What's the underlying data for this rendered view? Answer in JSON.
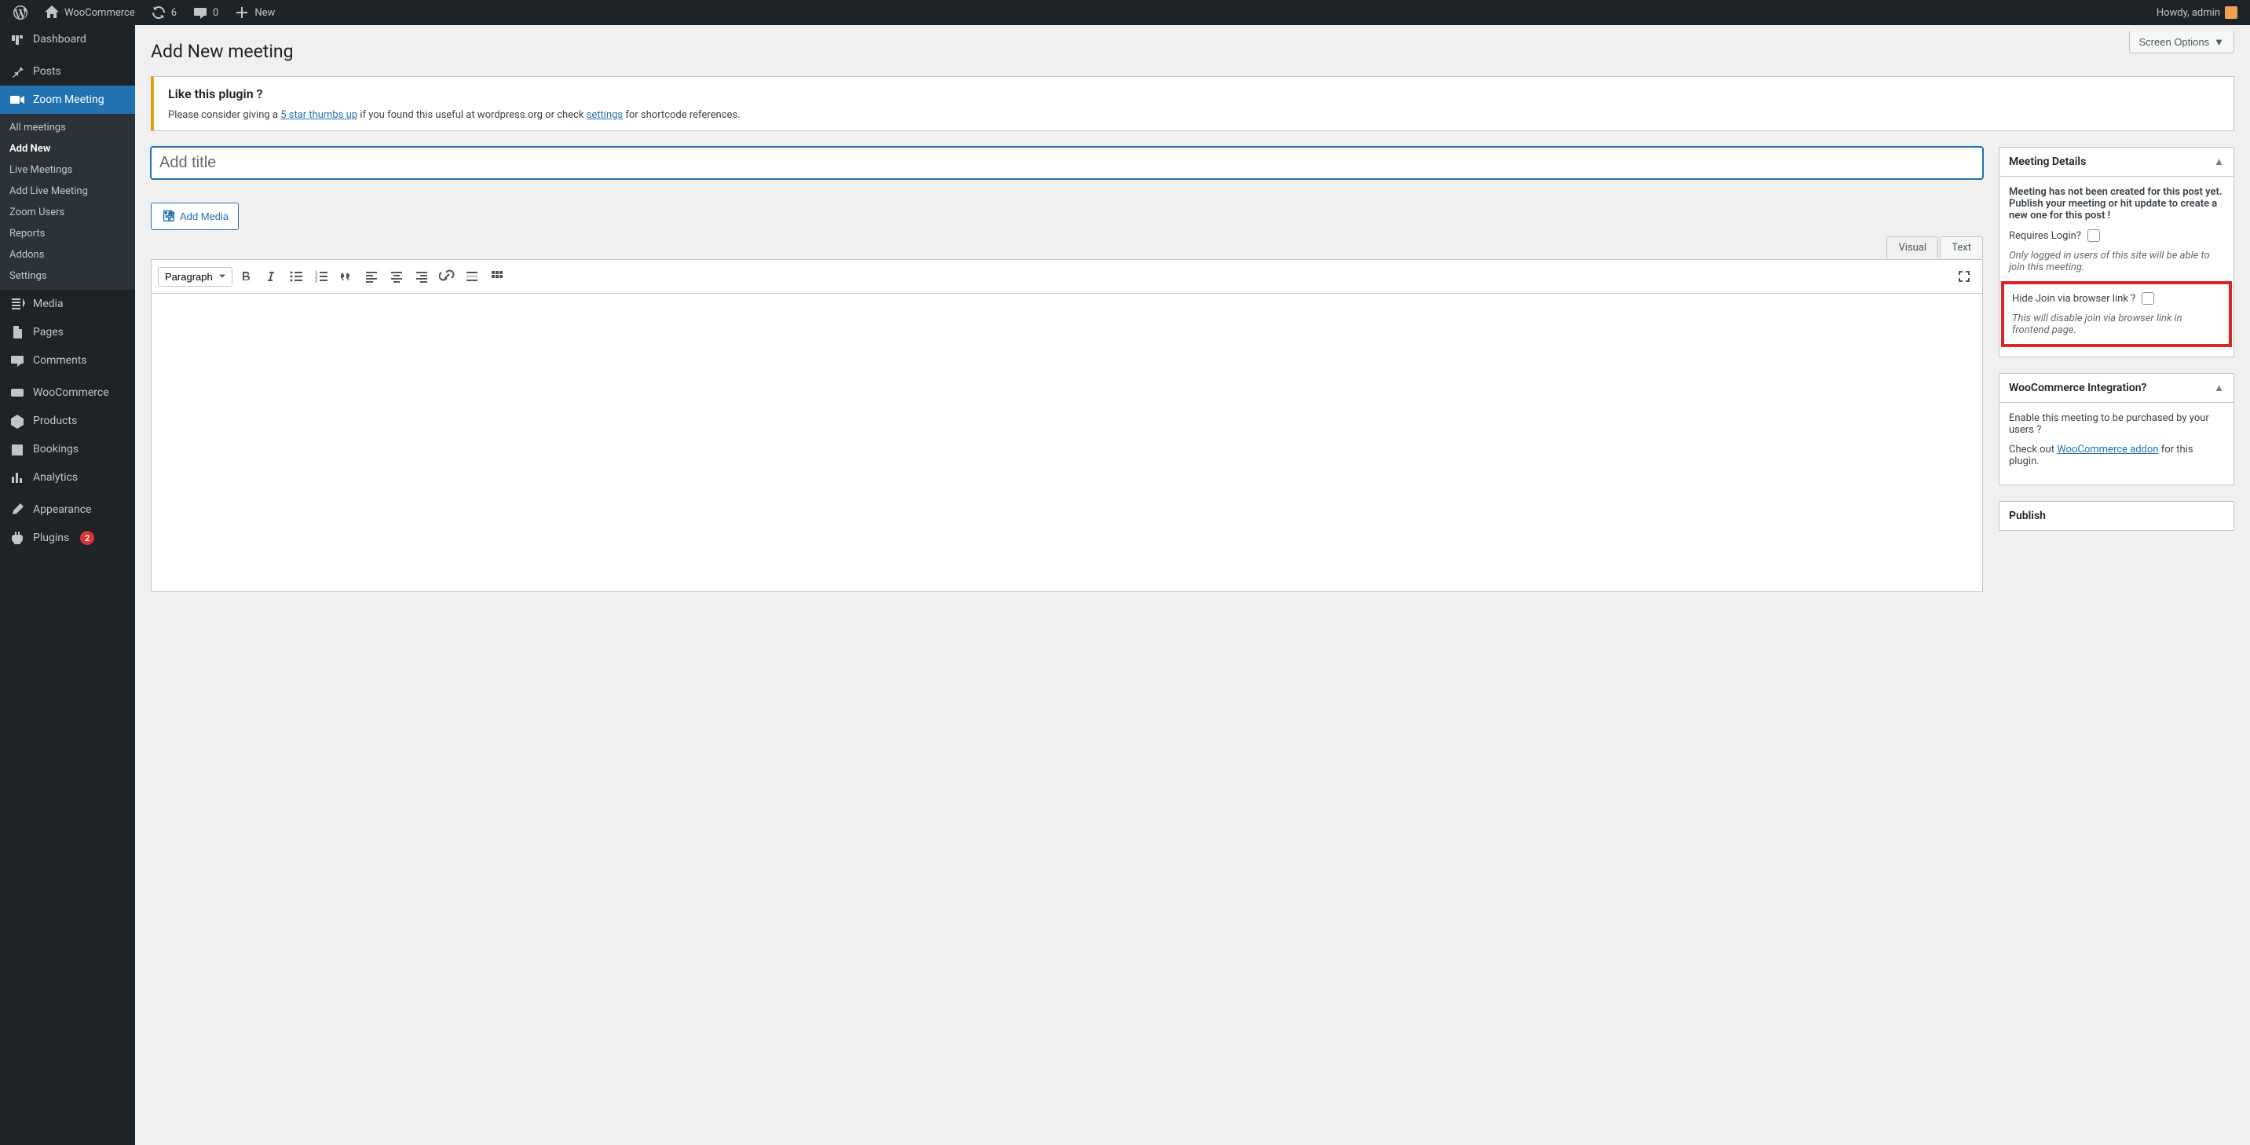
{
  "adminbar": {
    "site_name": "WooCommerce",
    "updates_count": "6",
    "comments_count": "0",
    "new_label": "New",
    "howdy": "Howdy, admin"
  },
  "sidebar": {
    "items": [
      {
        "label": "Dashboard"
      },
      {
        "label": "Posts"
      },
      {
        "label": "Zoom Meeting"
      },
      {
        "label": "Media"
      },
      {
        "label": "Pages"
      },
      {
        "label": "Comments"
      },
      {
        "label": "WooCommerce"
      },
      {
        "label": "Products"
      },
      {
        "label": "Bookings"
      },
      {
        "label": "Analytics"
      },
      {
        "label": "Appearance"
      },
      {
        "label": "Plugins"
      }
    ],
    "plugins_badge": "2",
    "zoom_submenu": [
      {
        "label": "All meetings"
      },
      {
        "label": "Add New"
      },
      {
        "label": "Live Meetings"
      },
      {
        "label": "Add Live Meeting"
      },
      {
        "label": "Zoom Users"
      },
      {
        "label": "Reports"
      },
      {
        "label": "Addons"
      },
      {
        "label": "Settings"
      }
    ]
  },
  "page": {
    "screen_options": "Screen Options",
    "heading": "Add New meeting",
    "title_placeholder": "Add title"
  },
  "notice": {
    "title": "Like this plugin ?",
    "pre": "Please consider giving a ",
    "link1": "5 star thumbs up",
    "mid": " if you found this useful at wordpress.org or check ",
    "link2": "settings",
    "post": " for shortcode references."
  },
  "editor": {
    "add_media": "Add Media",
    "tab_visual": "Visual",
    "tab_text": "Text",
    "format_select": "Paragraph"
  },
  "meta": {
    "details_title": "Meeting Details",
    "details_msg": "Meeting has not been created for this post yet. Publish your meeting or hit update to create a new one for this post !",
    "requires_login_label": "Requires Login?",
    "requires_login_desc": "Only logged in users of this site will be able to join this meeting.",
    "hide_browser_label": "Hide Join via browser link ?",
    "hide_browser_desc": "This will disable join via browser link in frontend page.",
    "woo_title": "WooCommerce Integration?",
    "woo_enable": "Enable this meeting to be purchased by your users ?",
    "woo_checkout_pre": "Check out ",
    "woo_addon_link": "WooCommerce addon",
    "woo_checkout_post": " for this plugin.",
    "publish_title": "Publish"
  }
}
